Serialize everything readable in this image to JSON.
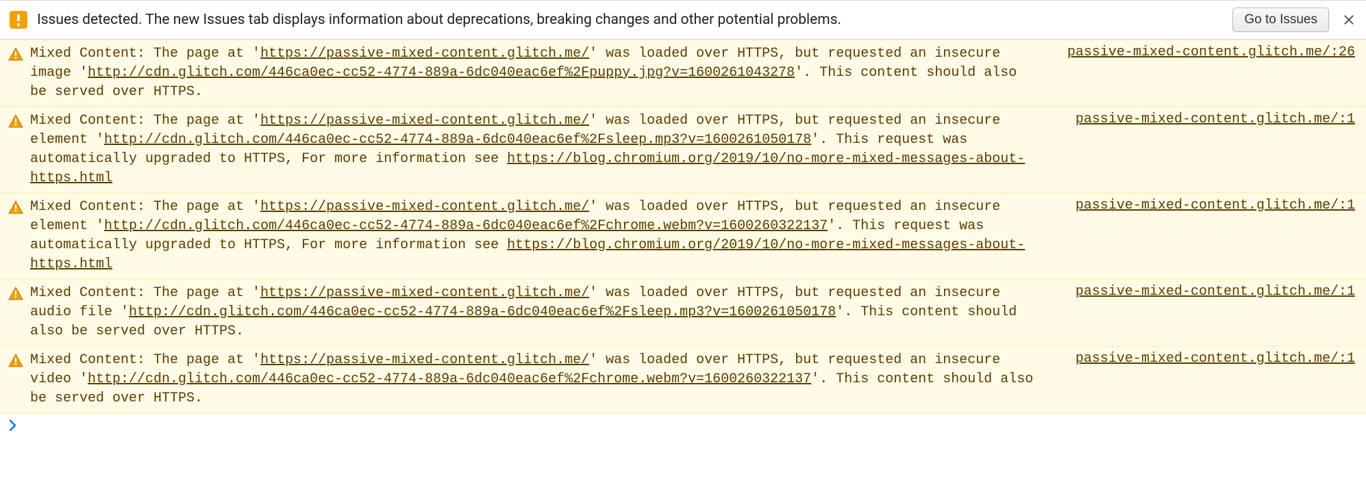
{
  "issues_bar": {
    "text": "Issues detected. The new Issues tab displays information about deprecations, breaking changes and other potential problems.",
    "button_label": "Go to Issues"
  },
  "messages": [
    {
      "parts": [
        {
          "t": "Mixed Content: The page at '"
        },
        {
          "t": "https://passive-mixed-content.glitch.me/",
          "link": true
        },
        {
          "t": "' was loaded over HTTPS, but requested an insecure image '"
        },
        {
          "t": "http://cdn.glitch.com/446ca0ec-cc52-4774-889a-6dc040eac6ef%2Fpuppy.jpg?v=1600261043278",
          "link": true
        },
        {
          "t": "'. This content should also be served over HTTPS."
        }
      ],
      "source": "passive-mixed-content.glitch.me/:26"
    },
    {
      "parts": [
        {
          "t": "Mixed Content: The page at '"
        },
        {
          "t": "https://passive-mixed-content.glitch.me/",
          "link": true
        },
        {
          "t": "' was loaded over HTTPS, but requested an insecure element '"
        },
        {
          "t": "http://cdn.glitch.com/446ca0ec-cc52-4774-889a-6dc040eac6ef%2Fsleep.mp3?v=1600261050178",
          "link": true
        },
        {
          "t": "'. This request was automatically upgraded to HTTPS, For more information see "
        },
        {
          "t": "https://blog.chromium.org/2019/10/no-more-mixed-messages-about-https.html",
          "link": true
        }
      ],
      "source": "passive-mixed-content.glitch.me/:1"
    },
    {
      "parts": [
        {
          "t": "Mixed Content: The page at '"
        },
        {
          "t": "https://passive-mixed-content.glitch.me/",
          "link": true
        },
        {
          "t": "' was loaded over HTTPS, but requested an insecure element '"
        },
        {
          "t": "http://cdn.glitch.com/446ca0ec-cc52-4774-889a-6dc040eac6ef%2Fchrome.webm?v=1600260322137",
          "link": true
        },
        {
          "t": "'. This request was automatically upgraded to HTTPS, For more information see "
        },
        {
          "t": "https://blog.chromium.org/2019/10/no-more-mixed-messages-about-https.html",
          "link": true
        }
      ],
      "source": "passive-mixed-content.glitch.me/:1"
    },
    {
      "parts": [
        {
          "t": "Mixed Content: The page at '"
        },
        {
          "t": "https://passive-mixed-content.glitch.me/",
          "link": true
        },
        {
          "t": "' was loaded over HTTPS, but requested an insecure audio file '"
        },
        {
          "t": "http://cdn.glitch.com/446ca0ec-cc52-4774-889a-6dc040eac6ef%2Fsleep.mp3?v=1600261050178",
          "link": true
        },
        {
          "t": "'. This content should also be served over HTTPS."
        }
      ],
      "source": "passive-mixed-content.glitch.me/:1"
    },
    {
      "parts": [
        {
          "t": "Mixed Content: The page at '"
        },
        {
          "t": "https://passive-mixed-content.glitch.me/",
          "link": true
        },
        {
          "t": "' was loaded over HTTPS, but requested an insecure video '"
        },
        {
          "t": "http://cdn.glitch.com/446ca0ec-cc52-4774-889a-6dc040eac6ef%2Fchrome.webm?v=1600260322137",
          "link": true
        },
        {
          "t": "'. This content should also be served over HTTPS."
        }
      ],
      "source": "passive-mixed-content.glitch.me/:1"
    }
  ]
}
